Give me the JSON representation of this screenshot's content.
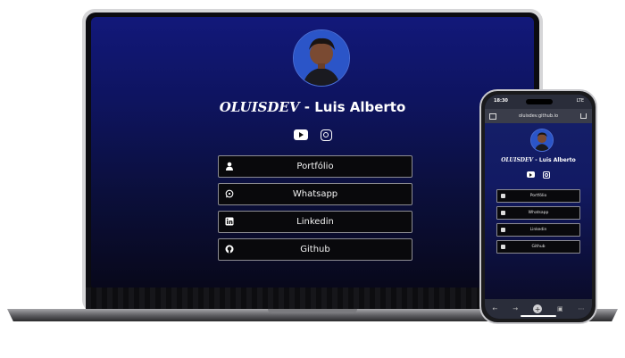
{
  "profile": {
    "brand": "OLUISDEV",
    "separator": "-",
    "name": "Luis Alberto"
  },
  "social": [
    {
      "icon": "youtube-icon"
    },
    {
      "icon": "instagram-icon"
    }
  ],
  "links": [
    {
      "label": "Portfólio",
      "icon": "user-icon"
    },
    {
      "label": "Whatsapp",
      "icon": "whatsapp-icon"
    },
    {
      "label": "Linkedin",
      "icon": "linkedin-icon"
    },
    {
      "label": "Github",
      "icon": "github-icon"
    }
  ],
  "phone": {
    "status_time": "18:30",
    "status_signal": "LTE",
    "url": "oluisdev.github.io"
  },
  "colors": {
    "background_top": "#12187a",
    "background_bottom": "#08081a",
    "button_bg": "#09090c",
    "button_border": "#8c8c92",
    "text": "#ffffff"
  }
}
